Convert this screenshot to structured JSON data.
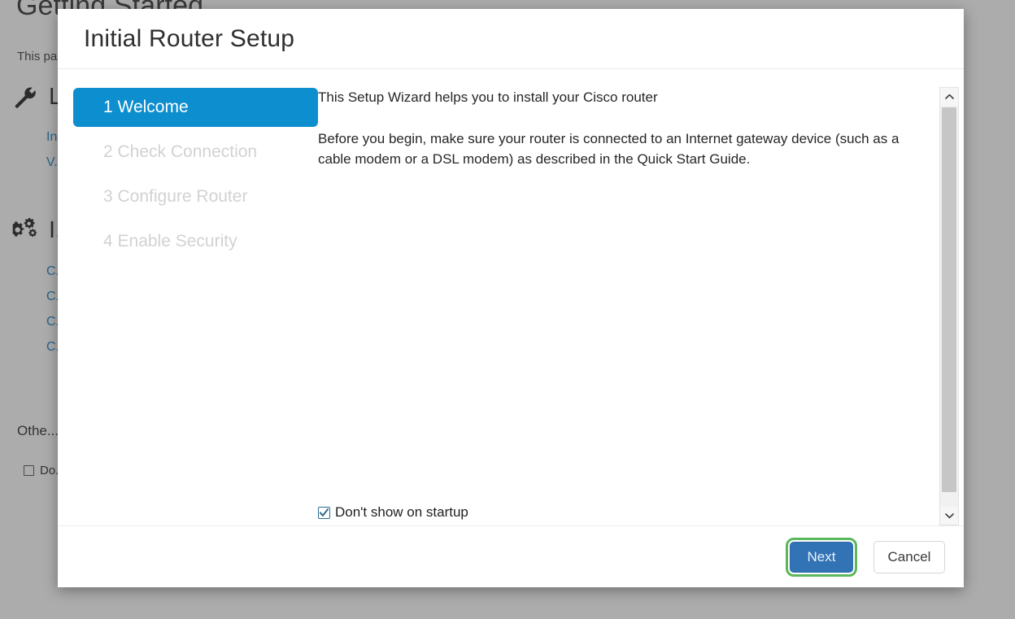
{
  "background": {
    "page_title": "Getting Started",
    "intro_text": "This page...",
    "sections": [
      {
        "icon": "wrench-icon",
        "glyph": "🔧",
        "title": "L...",
        "links": [
          "In...",
          "V..."
        ]
      },
      {
        "icon": "gears-icon",
        "glyph": "⚙",
        "title": "I...",
        "links": [
          "C...",
          "C...",
          "C...",
          "C..."
        ]
      }
    ],
    "other_title": "Othe...",
    "other_checkbox_label": "Do...",
    "other_checkbox_checked": false
  },
  "dialog": {
    "title": "Initial Router Setup",
    "steps": [
      {
        "label": "1 Welcome",
        "active": true
      },
      {
        "label": "2 Check Connection",
        "active": false
      },
      {
        "label": "3 Configure Router",
        "active": false
      },
      {
        "label": "4 Enable Security",
        "active": false
      }
    ],
    "content": {
      "paragraph_1": "This Setup Wizard helps you to install your Cisco router",
      "paragraph_2": "Before you begin, make sure your router is connected to an Internet gateway device (such as a cable modem or a DSL modem) as described in the Quick Start Guide.",
      "startup_checkbox_label": "Don't show on startup",
      "startup_checkbox_checked": true
    },
    "scrollbar": {
      "up_arrow": "chevron-up-icon",
      "down_arrow": "chevron-down-icon"
    },
    "footer": {
      "next_label": "Next",
      "cancel_label": "Cancel"
    }
  },
  "colors": {
    "active_step_blue": "#0d8ecf",
    "primary_button_blue": "#3273b5",
    "focus_ring_green": "#5cb85c",
    "link_blue": "#0f7dc2",
    "inactive_step_gray": "#d2d2d2"
  }
}
